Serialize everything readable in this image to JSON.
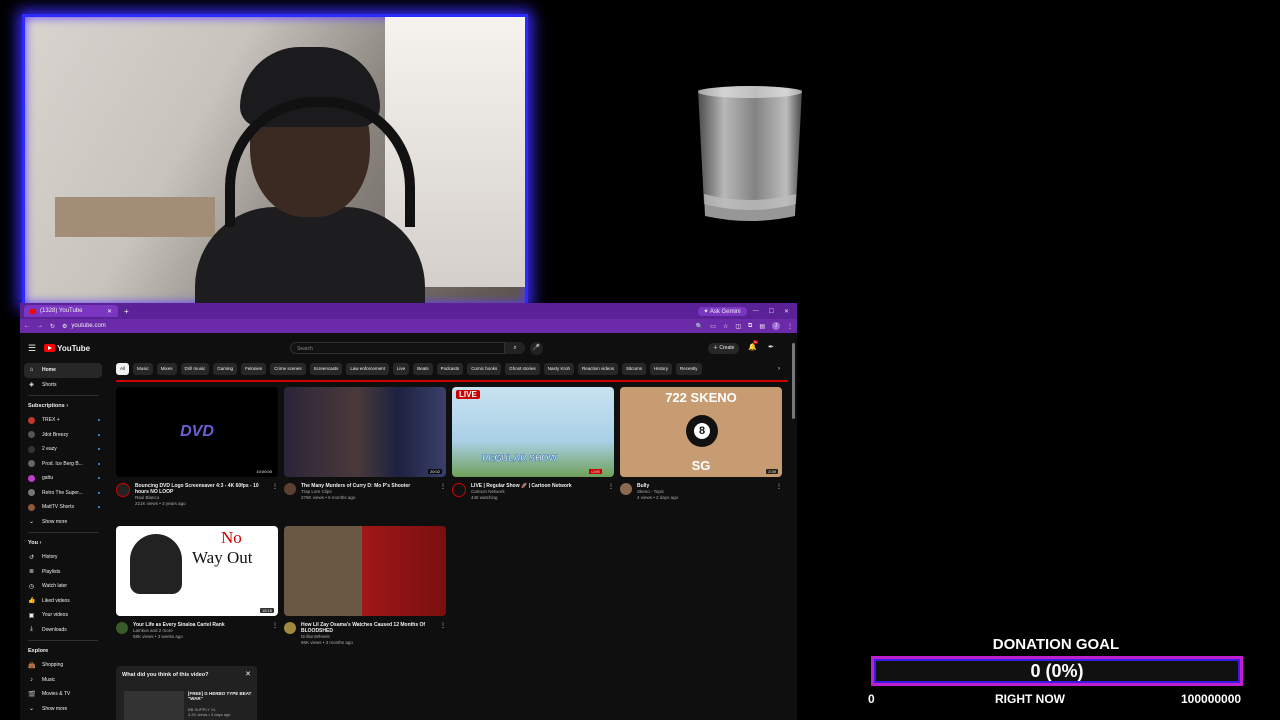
{
  "browser": {
    "tab_title": "(1328) YouTube",
    "url": "youtube.com",
    "ask_gemini": "Ask Gemini",
    "profile_initial": "J"
  },
  "youtube": {
    "logo": "YouTube",
    "search_placeholder": "Search",
    "create_label": "Create",
    "notification_count": "9+",
    "sidebar": {
      "home": "Home",
      "shorts": "Shorts",
      "subscriptions_heading": "Subscriptions",
      "subscriptions": [
        "TREX +",
        "Jdot Breezy",
        "2 eazy",
        "Prod. Ice Berg B...",
        "gattu",
        "Retro The Super...",
        "MattTV Shorts"
      ],
      "show_more": "Show more",
      "you_heading": "You",
      "you_items": [
        "History",
        "Playlists",
        "Watch later",
        "Liked videos",
        "Your videos",
        "Downloads"
      ],
      "explore_heading": "Explore",
      "explore_items": [
        "Shopping",
        "Music",
        "Movies & TV"
      ],
      "explore_show_more": "Show more"
    },
    "chips": [
      "All",
      "Music",
      "Mixes",
      "Drill music",
      "Gaming",
      "Felonies",
      "Crime scenes",
      "Screencasts",
      "Law enforcement",
      "Live",
      "Beats",
      "Podcasts",
      "Comic books",
      "Ghost stories",
      "Nasty Kroh",
      "Reaction videos",
      "Sitcoms",
      "History",
      "Recently"
    ],
    "videos": [
      {
        "title": "Bouncing DVD Logo Screensaver 4:3 - 4K 60fps - 10 hours NO LOOP",
        "channel": "Raul Blanco",
        "stats": "221K views • 3 years ago",
        "duration": "10:00:00",
        "thumb_text": "DVD"
      },
      {
        "title": "The Many Murders of Curry D: Mo P's Shooter",
        "channel": "Trap Lore Clips",
        "stats": "279K views • 6 months ago",
        "duration": "20:02"
      },
      {
        "title": "LIVE | Regular Show 🚀 | Cartoon Network",
        "channel": "Cartoon Network",
        "stats": "445 watching",
        "live_badge": "LIVE",
        "live_small": "LIVE",
        "thumb_text": "REGULAR SHOW"
      },
      {
        "title": "Bully",
        "channel": "Skeno - Topic",
        "stats": "4 views • 2 days ago",
        "duration": "2:39",
        "thumb_text_top": "722 SKENO",
        "thumb_text_bottom": "SG"
      },
      {
        "title": "Your Life as Every Sinaloa Cartel Rank",
        "channel": "Lamkus and 2 more",
        "stats": "58K views • 3 weeks ago",
        "duration": "15:16",
        "thumb_text_top": "No",
        "thumb_text_bottom": "Way Out"
      },
      {
        "title": "How Lil Zay Osama's Watches Caused 12 Months Of BLOODSHED",
        "channel": "DrillionWheels",
        "stats": "96K views • 3 months ago",
        "duration": ""
      }
    ],
    "survey": {
      "question": "What did you think of this video?",
      "video_title": "[FREE] G HERBO TYPE BEAT \"WAR\"",
      "video_channel": "BB SUPPLY XL",
      "video_stats": "3.2K views • 3 days ago"
    }
  },
  "donation": {
    "title": "DONATION GOAL",
    "value_text": "0 (0%)",
    "progress": 0,
    "min": "0",
    "status": "RIGHT NOW",
    "max": "100000000"
  }
}
